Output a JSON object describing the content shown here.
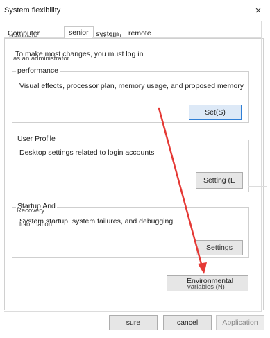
{
  "window": {
    "title": "System flexibility",
    "close_label": "×"
  },
  "tabs": [
    {
      "label": "Computer",
      "ghost": "Hardware"
    },
    {
      "label": "senior"
    },
    {
      "label": "system",
      "ghost": "protect"
    },
    {
      "label": "remote"
    }
  ],
  "admin_notice": {
    "text": "To make most changes, you must log in",
    "ghost": "as an administrator"
  },
  "performance": {
    "label": "performance",
    "description": "Visual effects, processor plan, memory usage, and proposed memory",
    "button": "Set(S)"
  },
  "user_profile": {
    "label": "User Profile",
    "description": "Desktop settings related to login accounts",
    "button": "Setting (E"
  },
  "startup": {
    "label": "Startup And",
    "ghost_label": "Recovery",
    "description": "System startup, system failures, and debugging",
    "ghost_description": "information",
    "button": "Settings"
  },
  "env_button": {
    "label": "Environmental",
    "ghost": "variables (N)"
  },
  "footer": {
    "ok": "sure",
    "cancel": "cancel",
    "apply": "Application"
  },
  "colors": {
    "annotation_arrow": "#e53935",
    "focus_border": "#2f7fd6"
  }
}
